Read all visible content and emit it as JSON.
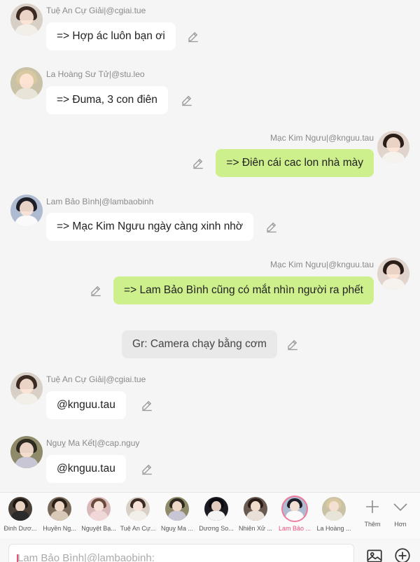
{
  "messages": [
    {
      "sender": "Tuệ An Cự Giải|@cgiai.tue",
      "text": "=> Hợp ác luôn bạn ơi"
    },
    {
      "sender": "La Hoàng Sư Tử|@stu.leo",
      "text": "=> Đuma, 3 con điên"
    },
    {
      "sender": "Mạc Kim Ngưu|@knguu.tau",
      "text": "=> Điên cái cac lon nhà mày"
    },
    {
      "sender": "Lam Bảo Bình|@lambaobinh",
      "text": "=> Mạc Kim Ngưu ngày càng xinh nhờ"
    },
    {
      "sender": "Mạc Kim Ngưu|@knguu.tau",
      "text": "=> Lam Bảo Bình cũng có mắt nhìn người ra phết"
    },
    {
      "text": "Gr: Camera chạy bằng cơm"
    },
    {
      "sender": "Tuệ An Cự Giải|@cgiai.tue",
      "text": "@knguu.tau"
    },
    {
      "sender": "Nguỵ Ma Kết|@cap.nguy",
      "text": "@knguu.tau"
    }
  ],
  "members": [
    {
      "name": "Đinh Dươ..."
    },
    {
      "name": "Huyền Ng..."
    },
    {
      "name": "Nguyệt Bạ..."
    },
    {
      "name": "Tuệ An Cự..."
    },
    {
      "name": "Nguỵ Ma ..."
    },
    {
      "name": "Dương So..."
    },
    {
      "name": "Nhiên Xử ..."
    },
    {
      "name": "Lam Bảo ..."
    },
    {
      "name": "La Hoàng ..."
    }
  ],
  "tools": {
    "add_label": "Thêm",
    "more_label": "Hơn"
  },
  "input": {
    "value": "Lam Bảo Bình|@lambaobinh:"
  },
  "colors": {
    "outgoing_bubble": "#cdef8c",
    "incoming_bubble": "#ffffff",
    "system_bubble": "#e9e9e9",
    "accent": "#e8507a",
    "background": "#f5f5f5"
  },
  "icons": {
    "edit": "pencil-icon",
    "add": "plus-icon",
    "more": "chevron-down-icon",
    "image": "image-icon",
    "attach": "plus-circle-icon"
  }
}
